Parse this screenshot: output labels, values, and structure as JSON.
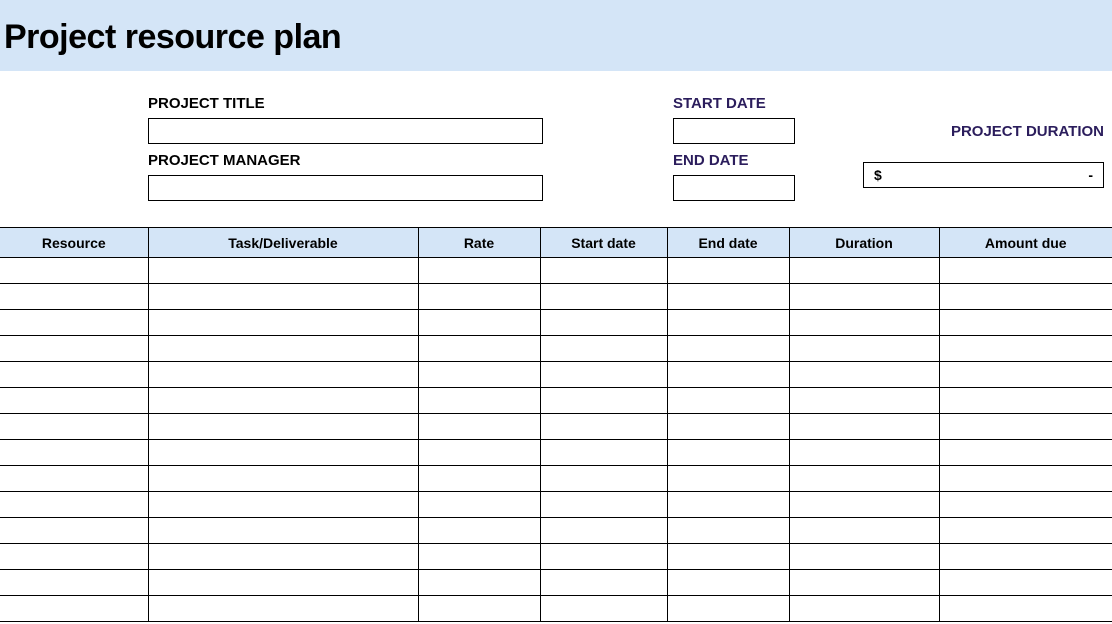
{
  "title": "Project resource plan",
  "meta": {
    "project_title_label": "PROJECT TITLE",
    "project_title_value": "",
    "project_manager_label": "PROJECT MANAGER",
    "project_manager_value": "",
    "start_date_label": "START DATE",
    "start_date_value": "",
    "end_date_label": "END DATE",
    "end_date_value": "",
    "duration_label": "PROJECT DURATION",
    "total_currency": "$",
    "total_value": "-"
  },
  "table": {
    "headers": {
      "resource": "Resource",
      "task": "Task/Deliverable",
      "rate": "Rate",
      "start": "Start date",
      "end": "End date",
      "duration": "Duration",
      "amount": "Amount due"
    },
    "rows": [
      {
        "resource": "",
        "task": "",
        "rate": "",
        "start": "",
        "end": "",
        "duration": "",
        "amount": ""
      },
      {
        "resource": "",
        "task": "",
        "rate": "",
        "start": "",
        "end": "",
        "duration": "",
        "amount": ""
      },
      {
        "resource": "",
        "task": "",
        "rate": "",
        "start": "",
        "end": "",
        "duration": "",
        "amount": ""
      },
      {
        "resource": "",
        "task": "",
        "rate": "",
        "start": "",
        "end": "",
        "duration": "",
        "amount": ""
      },
      {
        "resource": "",
        "task": "",
        "rate": "",
        "start": "",
        "end": "",
        "duration": "",
        "amount": ""
      },
      {
        "resource": "",
        "task": "",
        "rate": "",
        "start": "",
        "end": "",
        "duration": "",
        "amount": ""
      },
      {
        "resource": "",
        "task": "",
        "rate": "",
        "start": "",
        "end": "",
        "duration": "",
        "amount": ""
      },
      {
        "resource": "",
        "task": "",
        "rate": "",
        "start": "",
        "end": "",
        "duration": "",
        "amount": ""
      },
      {
        "resource": "",
        "task": "",
        "rate": "",
        "start": "",
        "end": "",
        "duration": "",
        "amount": ""
      },
      {
        "resource": "",
        "task": "",
        "rate": "",
        "start": "",
        "end": "",
        "duration": "",
        "amount": ""
      },
      {
        "resource": "",
        "task": "",
        "rate": "",
        "start": "",
        "end": "",
        "duration": "",
        "amount": ""
      },
      {
        "resource": "",
        "task": "",
        "rate": "",
        "start": "",
        "end": "",
        "duration": "",
        "amount": ""
      },
      {
        "resource": "",
        "task": "",
        "rate": "",
        "start": "",
        "end": "",
        "duration": "",
        "amount": ""
      },
      {
        "resource": "",
        "task": "",
        "rate": "",
        "start": "",
        "end": "",
        "duration": "",
        "amount": ""
      }
    ]
  }
}
